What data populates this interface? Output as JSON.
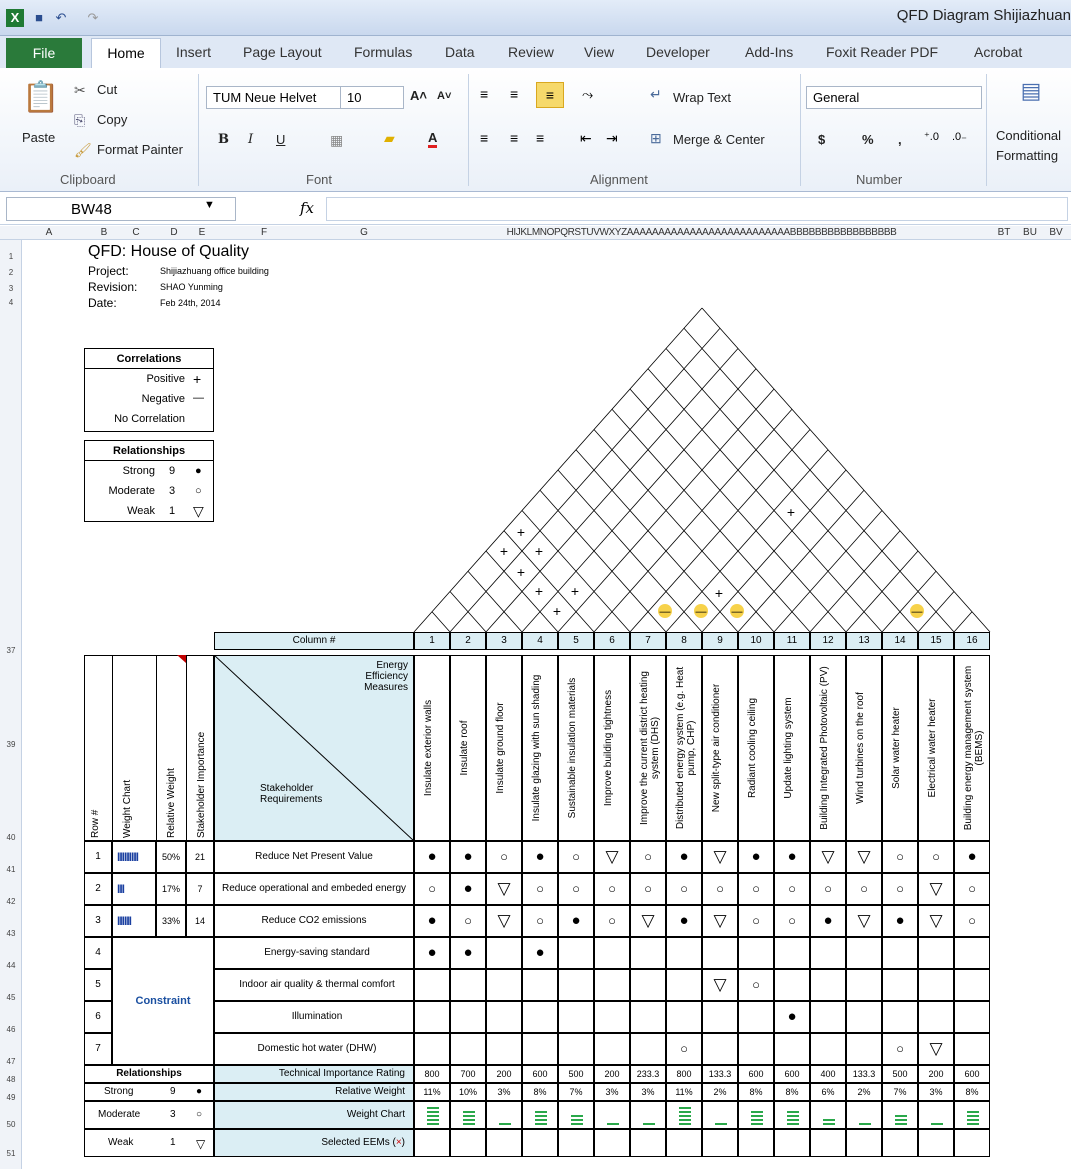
{
  "window": {
    "title": "QFD Diagram Shijiazhuan"
  },
  "tabs": [
    "File",
    "Home",
    "Insert",
    "Page Layout",
    "Formulas",
    "Data",
    "Review",
    "View",
    "Developer",
    "Add-Ins",
    "Foxit Reader PDF",
    "Acrobat"
  ],
  "ribbon": {
    "clipboard": {
      "paste": "Paste",
      "cut": "Cut",
      "copy": "Copy",
      "format_painter": "Format Painter",
      "label": "Clipboard"
    },
    "font": {
      "name": "TUM Neue Helvet",
      "size": "10",
      "label": "Font",
      "bold": "B",
      "italic": "I",
      "underline": "U"
    },
    "alignment": {
      "wrap": "Wrap Text",
      "merge": "Merge & Center",
      "label": "Alignment"
    },
    "number": {
      "format": "General",
      "label": "Number",
      "currency": "$",
      "percent": "%",
      "comma": ","
    },
    "styles": {
      "conditional": "Conditional",
      "formatting": "Formatting"
    }
  },
  "formula_bar": {
    "name_box": "BW48",
    "fx": "fx",
    "value": ""
  },
  "column_headers": [
    "A",
    "B",
    "C",
    "D",
    "E",
    "F",
    "G",
    "HIJKLMNOPQRSTUVWXYZAAAAAAAAAAAAAAAAAAAAAAAAAABBBBBBBBBBBBBBBBB",
    "BT",
    "BU",
    "BV"
  ],
  "qfd": {
    "title": "QFD: House of Quality",
    "project_label": "Project:",
    "project": "Shijiazhuang office building",
    "revision_label": "Revision:",
    "revision": "SHAO Yunming",
    "date_label": "Date:",
    "date": "Feb 24th, 2014",
    "correlations_title": "Correlations",
    "correlations": [
      {
        "label": "Positive",
        "sym": "+"
      },
      {
        "label": "Negative",
        "sym": "—"
      },
      {
        "label": "No Correlation",
        "sym": ""
      }
    ],
    "relationships_title": "Relationships",
    "relationships": [
      {
        "label": "Strong",
        "val": "9",
        "sym": "●"
      },
      {
        "label": "Moderate",
        "val": "3",
        "sym": "○"
      },
      {
        "label": "Weak",
        "val": "1",
        "sym": "▽"
      }
    ],
    "column_hash": "Column #",
    "row_hash": "Row #",
    "weight_chart": "Weight Chart",
    "relative_weight": "Relative Weight",
    "stakeholder_importance": "Stakeholder Importance",
    "eem_header": "Energy Efficiency Measures",
    "stakeholder_req": "Stakeholder Requirements",
    "columns": [
      "Insulate exterior walls",
      "Insulate roof",
      "Insulate ground floor",
      "Insulate glazing with sun shading",
      "Sustainable insulation materials",
      "Improve building tightness",
      "Improve the current district heating system (DHS)",
      "Distributed energy system (e.g. Heat pump, CHP)",
      "New split-type air conditioner",
      "Radiant cooling ceiling",
      "Update lighting system",
      "Building Integrated Photovoltaic (PV)",
      "Wind turbines on the roof",
      "Solar water heater",
      "Electrical water heater",
      "Building energy management system (BEMS)"
    ],
    "rows": [
      {
        "n": "1",
        "bars": "IIIIIIIII",
        "rw": "50%",
        "imp": "21",
        "req": "Reduce Net Present Value",
        "cells": [
          "●",
          "●",
          "○",
          "●",
          "○",
          "▽",
          "○",
          "●",
          "▽",
          "●",
          "●",
          "▽",
          "▽",
          "○",
          "○",
          "●"
        ]
      },
      {
        "n": "2",
        "bars": "III",
        "rw": "17%",
        "imp": "7",
        "req": "Reduce operational and embeded energy",
        "cells": [
          "○",
          "●",
          "▽",
          "○",
          "○",
          "○",
          "○",
          "○",
          "○",
          "○",
          "○",
          "○",
          "○",
          "○",
          "▽",
          "○"
        ]
      },
      {
        "n": "3",
        "bars": "IIIIII",
        "rw": "33%",
        "imp": "14",
        "req": "Reduce CO2 emissions",
        "cells": [
          "●",
          "○",
          "▽",
          "○",
          "●",
          "○",
          "▽",
          "●",
          "▽",
          "○",
          "○",
          "●",
          "▽",
          "●",
          "▽",
          "○"
        ]
      },
      {
        "n": "4",
        "req": "Energy-saving standard",
        "cells": [
          "●",
          "●",
          "",
          "●",
          "",
          "",
          "",
          "",
          "",
          "",
          "",
          "",
          "",
          "",
          "",
          ""
        ]
      },
      {
        "n": "5",
        "req": "Indoor air quality & thermal comfort",
        "cells": [
          "",
          "",
          "",
          "",
          "",
          "",
          "",
          "",
          "▽",
          "○",
          "",
          "",
          "",
          "",
          "",
          ""
        ]
      },
      {
        "n": "6",
        "req": "Illumination",
        "cells": [
          "",
          "",
          "",
          "",
          "",
          "",
          "",
          "",
          "",
          "",
          "●",
          "",
          "",
          "",
          "",
          ""
        ]
      },
      {
        "n": "7",
        "req": "Domestic hot water (DHW)",
        "cells": [
          "",
          "",
          "",
          "",
          "",
          "",
          "",
          "○",
          "",
          "",
          "",
          "",
          "",
          "○",
          "▽",
          ""
        ]
      }
    ],
    "constraint": "Constraint",
    "bottom_rel_title": "Relationships",
    "tir_label": "Technical Importance Rating",
    "rel_weight_label": "Relative Weight",
    "weight_chart_label": "Weight Chart",
    "selected_label": "Selected EEMs (×)",
    "tir": [
      "800",
      "700",
      "200",
      "600",
      "500",
      "200",
      "233.3",
      "800",
      "133.3",
      "600",
      "600",
      "400",
      "133.3",
      "500",
      "200",
      "600"
    ],
    "rw": [
      "11%",
      "10%",
      "3%",
      "8%",
      "7%",
      "3%",
      "3%",
      "11%",
      "2%",
      "8%",
      "8%",
      "6%",
      "2%",
      "7%",
      "3%",
      "8%"
    ],
    "wc": [
      5,
      4,
      1,
      4,
      3,
      1,
      1,
      5,
      1,
      4,
      4,
      2,
      1,
      3,
      1,
      4
    ]
  }
}
